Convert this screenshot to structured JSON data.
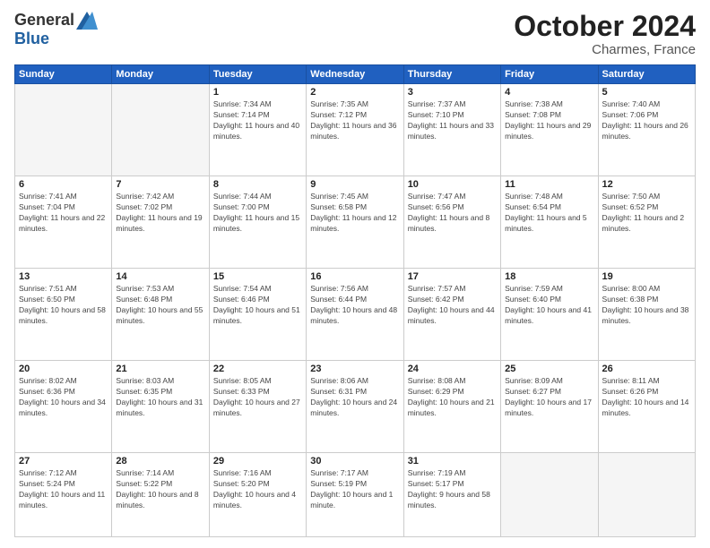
{
  "header": {
    "logo_general": "General",
    "logo_blue": "Blue",
    "month_title": "October 2024",
    "location": "Charmes, France"
  },
  "days_of_week": [
    "Sunday",
    "Monday",
    "Tuesday",
    "Wednesday",
    "Thursday",
    "Friday",
    "Saturday"
  ],
  "weeks": [
    [
      {
        "day": "",
        "info": ""
      },
      {
        "day": "",
        "info": ""
      },
      {
        "day": "1",
        "info": "Sunrise: 7:34 AM\nSunset: 7:14 PM\nDaylight: 11 hours and 40 minutes."
      },
      {
        "day": "2",
        "info": "Sunrise: 7:35 AM\nSunset: 7:12 PM\nDaylight: 11 hours and 36 minutes."
      },
      {
        "day": "3",
        "info": "Sunrise: 7:37 AM\nSunset: 7:10 PM\nDaylight: 11 hours and 33 minutes."
      },
      {
        "day": "4",
        "info": "Sunrise: 7:38 AM\nSunset: 7:08 PM\nDaylight: 11 hours and 29 minutes."
      },
      {
        "day": "5",
        "info": "Sunrise: 7:40 AM\nSunset: 7:06 PM\nDaylight: 11 hours and 26 minutes."
      }
    ],
    [
      {
        "day": "6",
        "info": "Sunrise: 7:41 AM\nSunset: 7:04 PM\nDaylight: 11 hours and 22 minutes."
      },
      {
        "day": "7",
        "info": "Sunrise: 7:42 AM\nSunset: 7:02 PM\nDaylight: 11 hours and 19 minutes."
      },
      {
        "day": "8",
        "info": "Sunrise: 7:44 AM\nSunset: 7:00 PM\nDaylight: 11 hours and 15 minutes."
      },
      {
        "day": "9",
        "info": "Sunrise: 7:45 AM\nSunset: 6:58 PM\nDaylight: 11 hours and 12 minutes."
      },
      {
        "day": "10",
        "info": "Sunrise: 7:47 AM\nSunset: 6:56 PM\nDaylight: 11 hours and 8 minutes."
      },
      {
        "day": "11",
        "info": "Sunrise: 7:48 AM\nSunset: 6:54 PM\nDaylight: 11 hours and 5 minutes."
      },
      {
        "day": "12",
        "info": "Sunrise: 7:50 AM\nSunset: 6:52 PM\nDaylight: 11 hours and 2 minutes."
      }
    ],
    [
      {
        "day": "13",
        "info": "Sunrise: 7:51 AM\nSunset: 6:50 PM\nDaylight: 10 hours and 58 minutes."
      },
      {
        "day": "14",
        "info": "Sunrise: 7:53 AM\nSunset: 6:48 PM\nDaylight: 10 hours and 55 minutes."
      },
      {
        "day": "15",
        "info": "Sunrise: 7:54 AM\nSunset: 6:46 PM\nDaylight: 10 hours and 51 minutes."
      },
      {
        "day": "16",
        "info": "Sunrise: 7:56 AM\nSunset: 6:44 PM\nDaylight: 10 hours and 48 minutes."
      },
      {
        "day": "17",
        "info": "Sunrise: 7:57 AM\nSunset: 6:42 PM\nDaylight: 10 hours and 44 minutes."
      },
      {
        "day": "18",
        "info": "Sunrise: 7:59 AM\nSunset: 6:40 PM\nDaylight: 10 hours and 41 minutes."
      },
      {
        "day": "19",
        "info": "Sunrise: 8:00 AM\nSunset: 6:38 PM\nDaylight: 10 hours and 38 minutes."
      }
    ],
    [
      {
        "day": "20",
        "info": "Sunrise: 8:02 AM\nSunset: 6:36 PM\nDaylight: 10 hours and 34 minutes."
      },
      {
        "day": "21",
        "info": "Sunrise: 8:03 AM\nSunset: 6:35 PM\nDaylight: 10 hours and 31 minutes."
      },
      {
        "day": "22",
        "info": "Sunrise: 8:05 AM\nSunset: 6:33 PM\nDaylight: 10 hours and 27 minutes."
      },
      {
        "day": "23",
        "info": "Sunrise: 8:06 AM\nSunset: 6:31 PM\nDaylight: 10 hours and 24 minutes."
      },
      {
        "day": "24",
        "info": "Sunrise: 8:08 AM\nSunset: 6:29 PM\nDaylight: 10 hours and 21 minutes."
      },
      {
        "day": "25",
        "info": "Sunrise: 8:09 AM\nSunset: 6:27 PM\nDaylight: 10 hours and 17 minutes."
      },
      {
        "day": "26",
        "info": "Sunrise: 8:11 AM\nSunset: 6:26 PM\nDaylight: 10 hours and 14 minutes."
      }
    ],
    [
      {
        "day": "27",
        "info": "Sunrise: 7:12 AM\nSunset: 5:24 PM\nDaylight: 10 hours and 11 minutes."
      },
      {
        "day": "28",
        "info": "Sunrise: 7:14 AM\nSunset: 5:22 PM\nDaylight: 10 hours and 8 minutes."
      },
      {
        "day": "29",
        "info": "Sunrise: 7:16 AM\nSunset: 5:20 PM\nDaylight: 10 hours and 4 minutes."
      },
      {
        "day": "30",
        "info": "Sunrise: 7:17 AM\nSunset: 5:19 PM\nDaylight: 10 hours and 1 minute."
      },
      {
        "day": "31",
        "info": "Sunrise: 7:19 AM\nSunset: 5:17 PM\nDaylight: 9 hours and 58 minutes."
      },
      {
        "day": "",
        "info": ""
      },
      {
        "day": "",
        "info": ""
      }
    ]
  ]
}
